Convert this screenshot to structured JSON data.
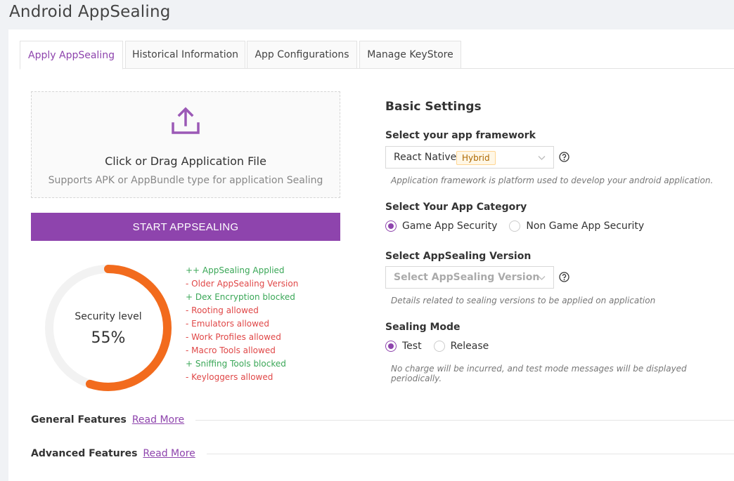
{
  "page": {
    "title": "Android AppSealing"
  },
  "tabs": [
    {
      "label": "Apply AppSealing",
      "active": true
    },
    {
      "label": "Historical Information",
      "active": false
    },
    {
      "label": "App Configurations",
      "active": false
    },
    {
      "label": "Manage KeyStore",
      "active": false
    }
  ],
  "upload": {
    "icon": "upload-icon",
    "title": "Click or Drag Application File",
    "subtitle": "Supports APK or AppBundle type for application Sealing"
  },
  "start_button": {
    "label": "START APPSEALING"
  },
  "security": {
    "label": "Security level",
    "value_text": "55%",
    "percent": 55
  },
  "features": [
    {
      "text": "++ AppSealing Applied",
      "status": "good"
    },
    {
      "text": "- Older AppSealing Version",
      "status": "bad"
    },
    {
      "text": "+ Dex Encryption blocked",
      "status": "good"
    },
    {
      "text": "- Rooting allowed",
      "status": "bad"
    },
    {
      "text": "- Emulators allowed",
      "status": "bad"
    },
    {
      "text": "- Work Profiles allowed",
      "status": "bad"
    },
    {
      "text": "- Macro Tools allowed",
      "status": "bad"
    },
    {
      "text": "+ Sniffing Tools blocked",
      "status": "good"
    },
    {
      "text": "- Keyloggers allowed",
      "status": "bad"
    }
  ],
  "basic_settings": {
    "title": "Basic Settings",
    "framework": {
      "label": "Select your app framework",
      "value": "React Native",
      "tag": "Hybrid",
      "hint": "Application framework is platform used to develop your android application."
    },
    "category": {
      "label": "Select Your App Category",
      "options": [
        {
          "label": "Game App Security",
          "checked": true
        },
        {
          "label": "Non Game App Security",
          "checked": false
        }
      ]
    },
    "version": {
      "label": "Select AppSealing Version",
      "placeholder": "Select AppSealing Version",
      "hint": "Details related to sealing versions to be applied on application"
    },
    "mode": {
      "label": "Sealing Mode",
      "options": [
        {
          "label": "Test",
          "checked": true
        },
        {
          "label": "Release",
          "checked": false
        }
      ],
      "hint": "No charge will be incurred, and test mode messages will be displayed periodically."
    }
  },
  "sections": [
    {
      "title": "General Features",
      "link": "Read More"
    },
    {
      "title": "Advanced Features",
      "link": "Read More"
    }
  ],
  "colors": {
    "accent": "#8e44ad",
    "gauge": "#f26b1d",
    "gauge_track": "#f2f2f2",
    "good": "#3aa757",
    "bad": "#e04848"
  }
}
